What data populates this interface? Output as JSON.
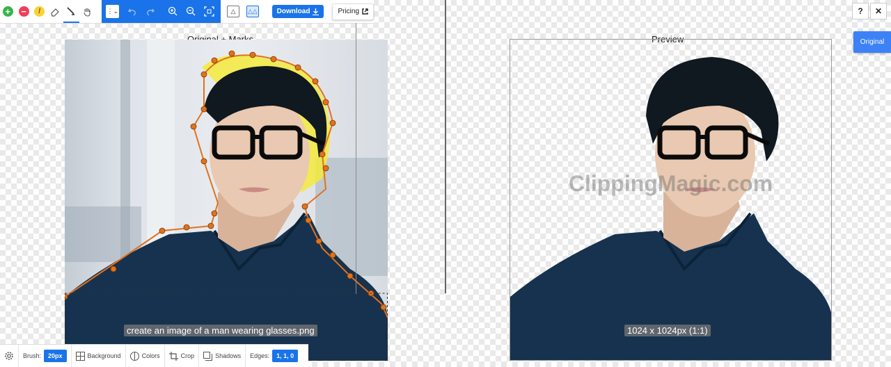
{
  "toolbar": {
    "download_label": "Download",
    "pricing_label": "Pricing"
  },
  "canvas": {
    "left_label": "Original + Marks",
    "right_label": "Preview",
    "filename": "create an image of a man wearing glasses.png",
    "dimensions": "1024 x 1024px (1:1)",
    "watermark": "ClippingMagic.com"
  },
  "side": {
    "help_label": "?",
    "close_label": "✕",
    "original_label": "Original"
  },
  "bottom": {
    "brush_label": "Brush:",
    "brush_value": "20px",
    "background_label": "Background",
    "colors_label": "Colors",
    "crop_label": "Crop",
    "shadows_label": "Shadows",
    "edges_label": "Edges:",
    "edges_value": "1, 1, 0"
  },
  "colors": {
    "accent": "#1a73e8",
    "keep": "#37b24d",
    "remove": "#f03e5a",
    "hair_brush": "#fbd22f",
    "marker": "#e2711d"
  }
}
